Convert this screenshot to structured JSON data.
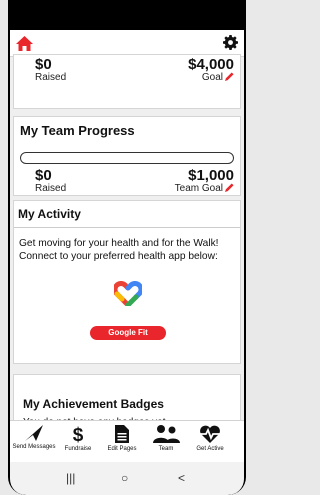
{
  "colors": {
    "accent": "#e8262b",
    "background": "#efefef"
  },
  "topbar": {
    "home_icon": "home-icon",
    "settings_icon": "gear-icon"
  },
  "fundraising": {
    "raised_value": "$0",
    "raised_label": "Raised",
    "goal_value": "$4,000",
    "goal_label": "Goal"
  },
  "team_progress": {
    "title": "My Team Progress",
    "progress_fraction": 0,
    "raised_value": "$0",
    "raised_label": "Raised",
    "goal_value": "$1,000",
    "goal_label": "Team Goal"
  },
  "activity": {
    "title": "My Activity",
    "message": "Get moving for your health and for the Walk! Connect to your preferred health app below:",
    "button_label": "Google Fit"
  },
  "badges": {
    "title": "My Achievement Badges",
    "message": "You do not have any badges yet."
  },
  "bottom_nav": {
    "items": [
      {
        "label": "Send Messages",
        "icon": "send-icon"
      },
      {
        "label": "Fundraise",
        "icon": "dollar-icon"
      },
      {
        "label": "Edit Pages",
        "icon": "page-icon"
      },
      {
        "label": "Team",
        "icon": "team-icon"
      },
      {
        "label": "Get Active",
        "icon": "heartbeat-icon"
      }
    ]
  },
  "system_nav": {
    "recent": "|||",
    "home": "○",
    "back": "<"
  }
}
